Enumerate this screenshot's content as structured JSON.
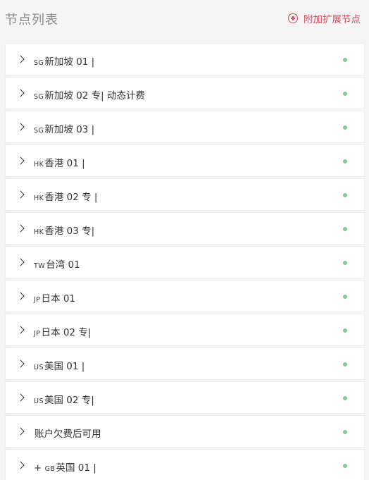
{
  "header": {
    "title": "节点列表",
    "add_label": "附加扩展节点"
  },
  "colors": {
    "accent": "#d84a5a",
    "status_online": "#7fcf8c"
  },
  "nodes": [
    {
      "prefix": "",
      "code": "SG",
      "name": "新加坡 01 |"
    },
    {
      "prefix": "",
      "code": "SG",
      "name": "新加坡 02 专| 动态计费"
    },
    {
      "prefix": "",
      "code": "SG",
      "name": "新加坡 03 |"
    },
    {
      "prefix": "",
      "code": "HK",
      "name": "香港 01 |"
    },
    {
      "prefix": "",
      "code": "HK",
      "name": "香港 02 专 |"
    },
    {
      "prefix": "",
      "code": "HK",
      "name": "香港 03 专|"
    },
    {
      "prefix": "",
      "code": "TW",
      "name": "台湾 01"
    },
    {
      "prefix": "",
      "code": "JP",
      "name": "日本 01"
    },
    {
      "prefix": "",
      "code": "JP",
      "name": "日本 02 专|"
    },
    {
      "prefix": "",
      "code": "US",
      "name": "美国 01 |"
    },
    {
      "prefix": "",
      "code": "US",
      "name": "美国 02 专|"
    },
    {
      "prefix": "",
      "code": "",
      "name": "账户欠费后可用"
    },
    {
      "prefix": "+ ",
      "code": "GB",
      "name": "英国 01 |"
    }
  ]
}
